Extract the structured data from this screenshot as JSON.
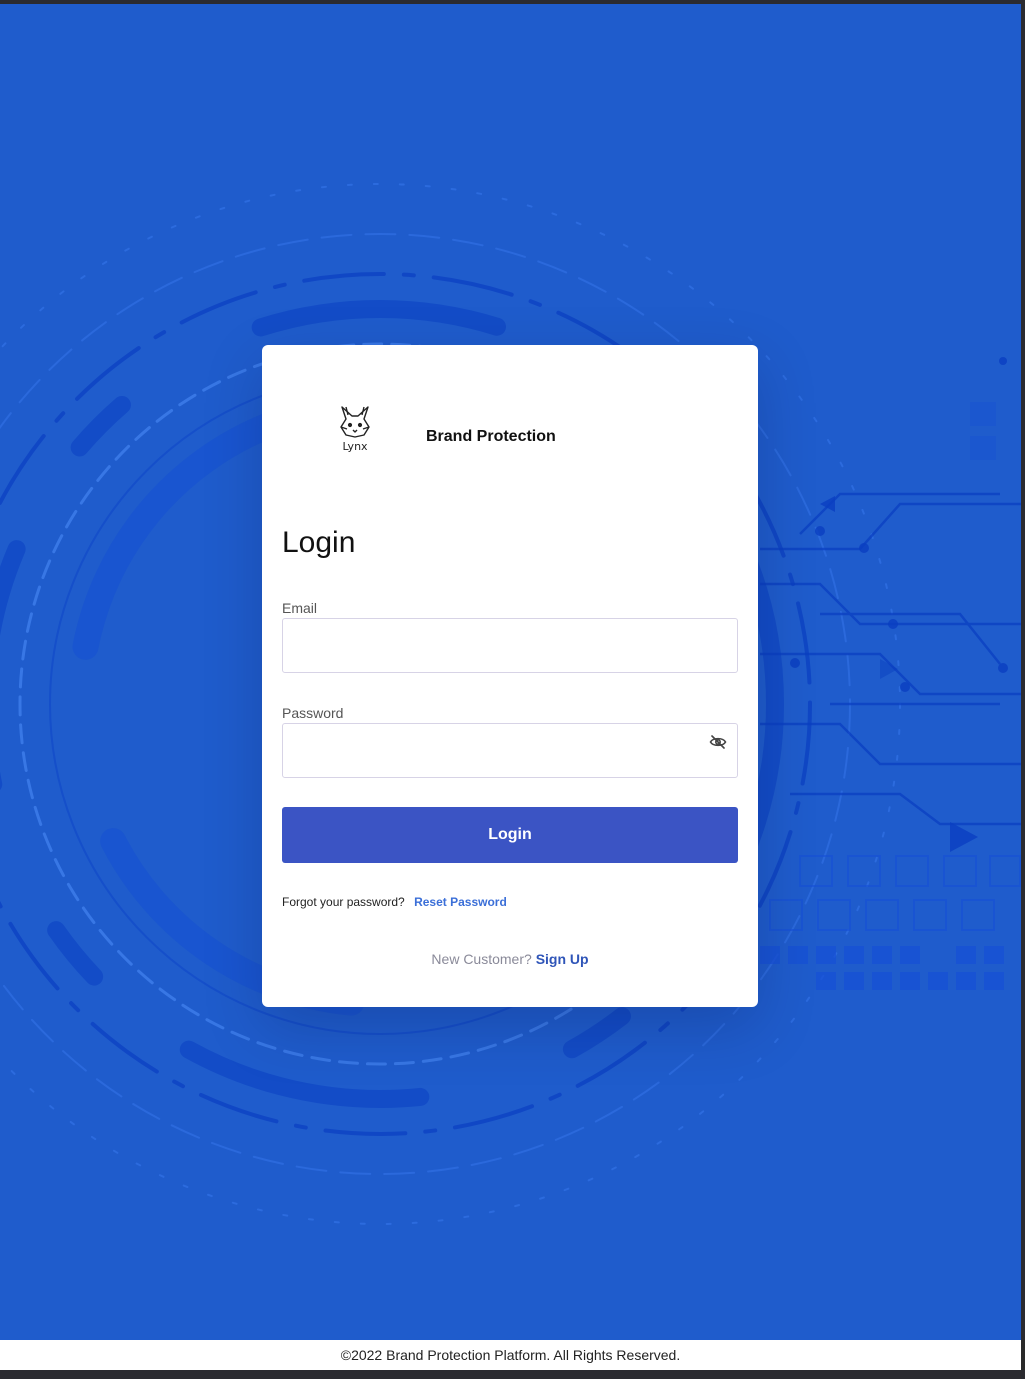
{
  "brand": {
    "logo_text": "Lynx",
    "name": "Brand Protection"
  },
  "login": {
    "title": "Login",
    "email_label": "Email",
    "email_value": "",
    "password_label": "Password",
    "password_value": "",
    "submit_label": "Login",
    "forgot_text": "Forgot your password?",
    "reset_link": "Reset Password",
    "new_customer_text": "New Customer?",
    "signup_link": "Sign Up"
  },
  "icons": {
    "password_toggle": "eye-off-icon",
    "logo": "lynx-logo-icon"
  },
  "footer": {
    "text": "©2022 Brand Protection Platform. All Rights Reserved."
  },
  "colors": {
    "background": "#1f5ccc",
    "primary_button": "#3b54c4",
    "link": "#3b6fd8",
    "card": "#ffffff"
  }
}
